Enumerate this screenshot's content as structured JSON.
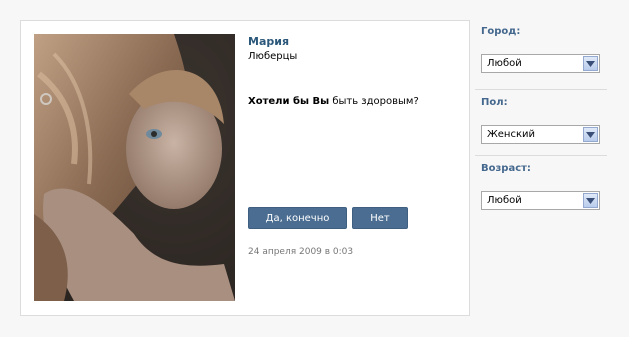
{
  "profile": {
    "name": "Мария",
    "city": "Люберцы"
  },
  "poll": {
    "question_bold": "Хотели бы Вы",
    "question_rest": " быть здоровым?",
    "yes_label": "Да, конечно",
    "no_label": "Нет",
    "date": "24 апреля 2009 в 0:03"
  },
  "filters": {
    "city": {
      "label": "Город:",
      "value": "Любой"
    },
    "gender": {
      "label": "Пол:",
      "value": "Женский"
    },
    "age": {
      "label": "Возраст:",
      "value": "Любой"
    }
  },
  "colors": {
    "accent": "#45688e",
    "button": "#4a6d91",
    "name": "#2b587a"
  }
}
